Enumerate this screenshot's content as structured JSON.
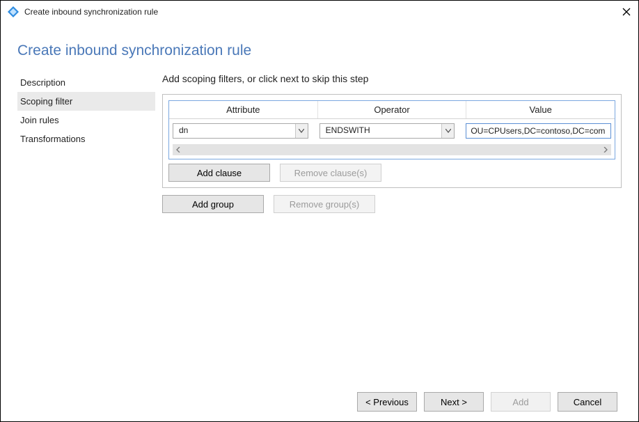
{
  "window": {
    "title": "Create inbound synchronization rule"
  },
  "page": {
    "title": "Create inbound synchronization rule"
  },
  "sidebar": {
    "items": [
      {
        "label": "Description",
        "active": false
      },
      {
        "label": "Scoping filter",
        "active": true
      },
      {
        "label": "Join rules",
        "active": false
      },
      {
        "label": "Transformations",
        "active": false
      }
    ]
  },
  "main": {
    "instruction": "Add scoping filters, or click next to skip this step",
    "columns": {
      "attribute": "Attribute",
      "operator": "Operator",
      "value": "Value"
    },
    "row": {
      "attribute": "dn",
      "operator": "ENDSWITH",
      "value": "OU=CPUsers,DC=contoso,DC=com"
    },
    "buttons": {
      "add_clause": "Add clause",
      "remove_clause": "Remove clause(s)",
      "add_group": "Add group",
      "remove_group": "Remove group(s)"
    }
  },
  "footer": {
    "previous": "< Previous",
    "next": "Next >",
    "add": "Add",
    "cancel": "Cancel"
  }
}
